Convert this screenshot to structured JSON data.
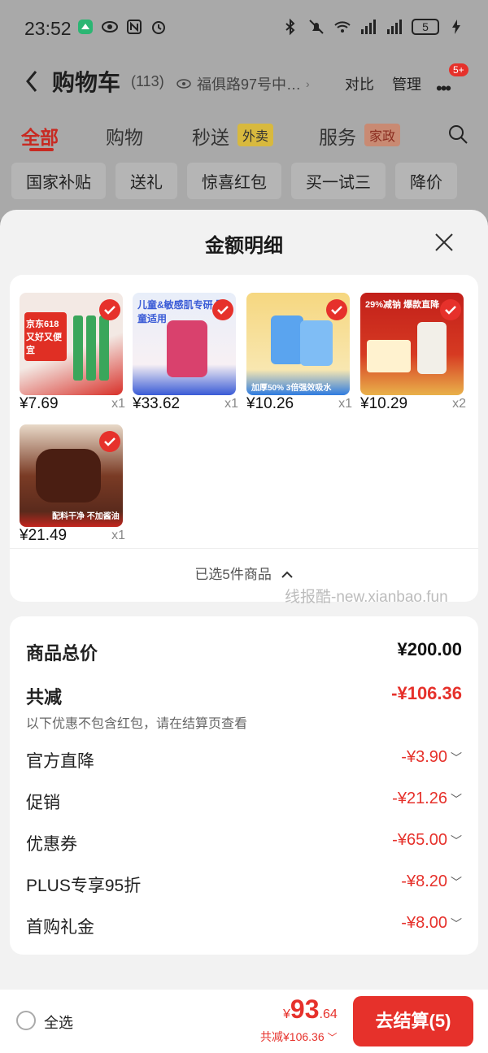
{
  "status_bar": {
    "time": "23:52",
    "battery": "5"
  },
  "cart_header": {
    "title": "购物车",
    "count": "(113)",
    "address": "福俱路97号中…",
    "compare": "对比",
    "manage": "管理",
    "message_badge": "5+"
  },
  "tabs": [
    {
      "label": "全部"
    },
    {
      "label": "购物"
    },
    {
      "label": "秒送"
    },
    {
      "label": "服务"
    }
  ],
  "tab_tags": {
    "waimai": "外卖",
    "jiazheng": "家政"
  },
  "chips": [
    "国家补贴",
    "送礼",
    "惊喜红包",
    "买一试三",
    "降价"
  ],
  "sheet": {
    "title": "金额明细",
    "selected_toggle": "已选5件商品",
    "watermark": "线报酷-new.xianbao.fun"
  },
  "products": [
    {
      "price": "¥7.69",
      "qty": "x1",
      "thumb_text": "京东618 又好又便宜",
      "colors": [
        "#f3e9e4",
        "#d8312a"
      ]
    },
    {
      "price": "¥33.62",
      "qty": "x1",
      "thumb_text": "儿童&敏感肌专研 婴童适用",
      "colors": [
        "#e8eef9",
        "#3a5bd6"
      ]
    },
    {
      "price": "¥10.26",
      "qty": "x1",
      "thumb_text": "加厚50% 3倍强效吸水",
      "colors": [
        "#f6d780",
        "#2f7ce0"
      ]
    },
    {
      "price": "¥10.29",
      "qty": "x2",
      "thumb_text": "29%减钠 爆款直降",
      "colors": [
        "#c21f1a",
        "#e9b14a"
      ]
    },
    {
      "price": "¥21.49",
      "qty": "x1",
      "thumb_text": "配料干净 不加酱油",
      "colors": [
        "#5a2a1c",
        "#e8d9c8"
      ]
    }
  ],
  "summary": {
    "total_label": "商品总价",
    "total_value": "¥200.00",
    "discount_label": "共减",
    "discount_value": "-¥106.36",
    "note": "以下优惠不包含红包，请在结算页查看",
    "items": [
      {
        "label": "官方直降",
        "value": "-¥3.90"
      },
      {
        "label": "促销",
        "value": "-¥21.26"
      },
      {
        "label": "优惠券",
        "value": "-¥65.00"
      },
      {
        "label": "PLUS专享95折",
        "value": "-¥8.20"
      },
      {
        "label": "首购礼金",
        "value": "-¥8.00"
      }
    ]
  },
  "bottom_bar": {
    "select_all": "全选",
    "currency": "¥",
    "price_int": "93",
    "price_dec": ".64",
    "discount": "共减¥106.36",
    "checkout": "去结算(5)"
  },
  "colors": {
    "accent": "#e6312b",
    "sheet_bg": "#f2f2f2"
  }
}
